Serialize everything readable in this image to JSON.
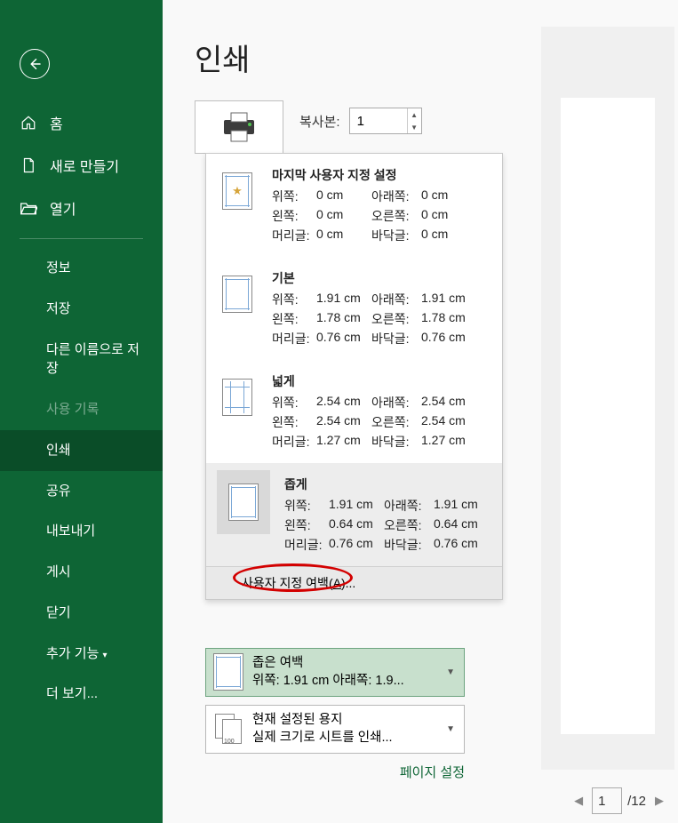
{
  "title": "인쇄",
  "sidebar": {
    "top": [
      {
        "label": "홈",
        "icon": "home-icon"
      },
      {
        "label": "새로 만들기",
        "icon": "new-file-icon"
      },
      {
        "label": "열기",
        "icon": "open-folder-icon"
      }
    ],
    "sub": [
      {
        "label": "정보"
      },
      {
        "label": "저장"
      },
      {
        "label": "다른 이름으로 저장"
      },
      {
        "label": "사용 기록",
        "disabled": true
      },
      {
        "label": "인쇄",
        "active": true
      },
      {
        "label": "공유"
      },
      {
        "label": "내보내기"
      },
      {
        "label": "게시"
      },
      {
        "label": "닫기"
      },
      {
        "label": "추가 기능"
      },
      {
        "label": "더 보기..."
      }
    ]
  },
  "copies": {
    "label": "복사본:",
    "value": "1"
  },
  "marginsDropdown": {
    "options": [
      {
        "title": "마지막 사용자 지정 설정",
        "kind": "last",
        "rows": [
          {
            "l1": "위쪽:",
            "v1": "0 cm",
            "l2": "아래쪽:",
            "v2": "0 cm"
          },
          {
            "l1": "왼쪽:",
            "v1": "0 cm",
            "l2": "오른쪽:",
            "v2": "0 cm"
          },
          {
            "l1": "머리글:",
            "v1": "0 cm",
            "l2": "바닥글:",
            "v2": "0 cm"
          }
        ]
      },
      {
        "title": "기본",
        "kind": "normal",
        "rows": [
          {
            "l1": "위쪽:",
            "v1": "1.91 cm",
            "l2": "아래쪽:",
            "v2": "1.91 cm"
          },
          {
            "l1": "왼쪽:",
            "v1": "1.78 cm",
            "l2": "오른쪽:",
            "v2": "1.78 cm"
          },
          {
            "l1": "머리글:",
            "v1": "0.76 cm",
            "l2": "바닥글:",
            "v2": "0.76 cm"
          }
        ]
      },
      {
        "title": "넓게",
        "kind": "wide",
        "rows": [
          {
            "l1": "위쪽:",
            "v1": "2.54 cm",
            "l2": "아래쪽:",
            "v2": "2.54 cm"
          },
          {
            "l1": "왼쪽:",
            "v1": "2.54 cm",
            "l2": "오른쪽:",
            "v2": "2.54 cm"
          },
          {
            "l1": "머리글:",
            "v1": "1.27 cm",
            "l2": "바닥글:",
            "v2": "1.27 cm"
          }
        ]
      },
      {
        "title": "좁게",
        "kind": "narrow",
        "hover": true,
        "rows": [
          {
            "l1": "위쪽:",
            "v1": "1.91 cm",
            "l2": "아래쪽:",
            "v2": "1.91 cm"
          },
          {
            "l1": "왼쪽:",
            "v1": "0.64 cm",
            "l2": "오른쪽:",
            "v2": "0.64 cm"
          },
          {
            "l1": "머리글:",
            "v1": "0.76 cm",
            "l2": "바닥글:",
            "v2": "0.76 cm"
          }
        ]
      }
    ],
    "custom": {
      "label_pre": "사용자 지정 여백(",
      "hotkey": "A",
      "label_post": ")..."
    }
  },
  "settingRowMargins": {
    "line1": "좁은 여백",
    "line2": "위쪽: 1.91 cm 아래쪽: 1.9..."
  },
  "settingRowPaper": {
    "line1": "현재 설정된 용지",
    "line2": "실제 크기로 시트를 인쇄...",
    "num": "100"
  },
  "pageSetupLink": "페이지 설정",
  "pager": {
    "current": "1",
    "total": "/12"
  }
}
